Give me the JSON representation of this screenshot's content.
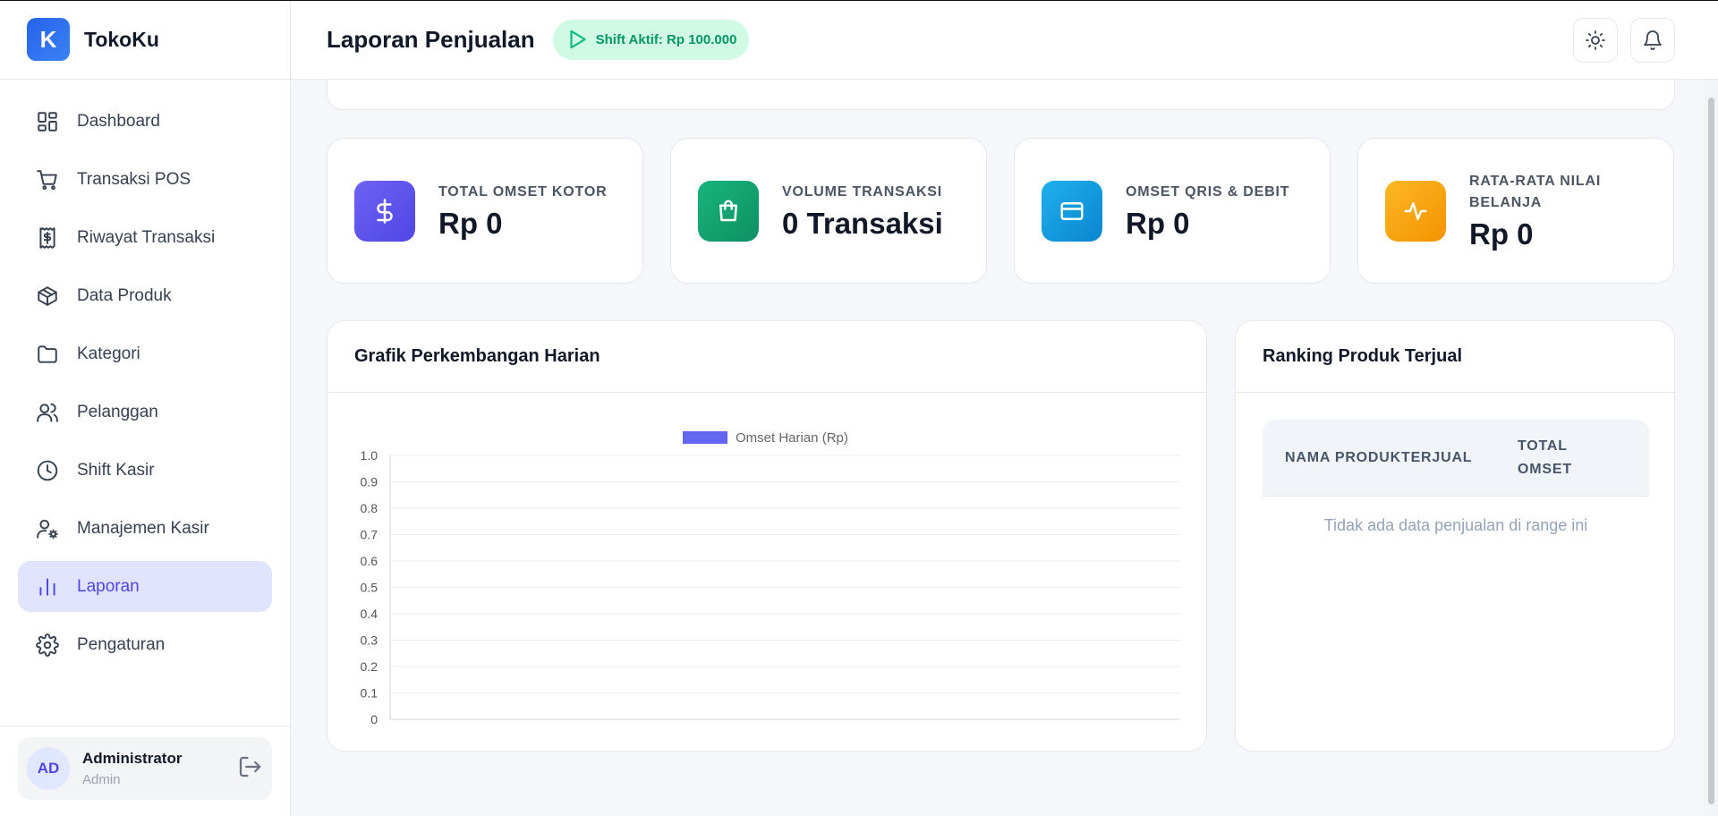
{
  "brand": {
    "logo_letter": "K",
    "name": "TokoKu"
  },
  "sidebar": {
    "items": [
      {
        "label": "Dashboard",
        "icon": "dashboard-icon"
      },
      {
        "label": "Transaksi POS",
        "icon": "cart-icon"
      },
      {
        "label": "Riwayat Transaksi",
        "icon": "receipt-icon"
      },
      {
        "label": "Data Produk",
        "icon": "box-icon"
      },
      {
        "label": "Kategori",
        "icon": "folder-icon"
      },
      {
        "label": "Pelanggan",
        "icon": "users-icon"
      },
      {
        "label": "Shift Kasir",
        "icon": "clock-icon"
      },
      {
        "label": "Manajemen Kasir",
        "icon": "user-gear-icon"
      },
      {
        "label": "Laporan",
        "icon": "bar-chart-icon",
        "active": true
      },
      {
        "label": "Pengaturan",
        "icon": "gear-icon"
      }
    ],
    "active_color": "#4f46e5",
    "active_bg": "#e0e4fd"
  },
  "user": {
    "initials": "AD",
    "name": "Administrator",
    "role": "Admin"
  },
  "header": {
    "title": "Laporan Penjualan",
    "shift_badge": "Shift Aktif: Rp 100.000"
  },
  "stats": [
    {
      "label": "TOTAL OMSET KOTOR",
      "value": "Rp 0",
      "icon": "dollar-icon",
      "color": "#5b50e8"
    },
    {
      "label": "VOLUME TRANSAKSI",
      "value": "0 Transaksi",
      "icon": "shopping-bag-icon",
      "color": "#10a36f"
    },
    {
      "label": "OMSET QRIS & DEBIT",
      "value": "Rp 0",
      "icon": "credit-card-icon",
      "color": "#0e9be0"
    },
    {
      "label": "RATA-RATA NILAI BELANJA",
      "value": "Rp 0",
      "icon": "activity-icon",
      "color": "#f5a00f"
    }
  ],
  "chart_panel": {
    "title": "Grafik Perkembangan Harian"
  },
  "chart_data": {
    "type": "bar",
    "series": [
      {
        "name": "Omset Harian (Rp)",
        "values": [],
        "color": "#6366f1"
      }
    ],
    "categories": [],
    "ylim": [
      0,
      1.0
    ],
    "yticks": [
      "0",
      "0.1",
      "0.2",
      "0.3",
      "0.4",
      "0.5",
      "0.6",
      "0.7",
      "0.8",
      "0.9",
      "1.0"
    ],
    "grid": true,
    "legend": "top-center"
  },
  "ranking": {
    "title": "Ranking Produk Terjual",
    "columns": [
      "NAMA PRODUK",
      "TERJUAL",
      "TOTAL OMSET"
    ],
    "empty_text": "Tidak ada data penjualan di range ini"
  }
}
